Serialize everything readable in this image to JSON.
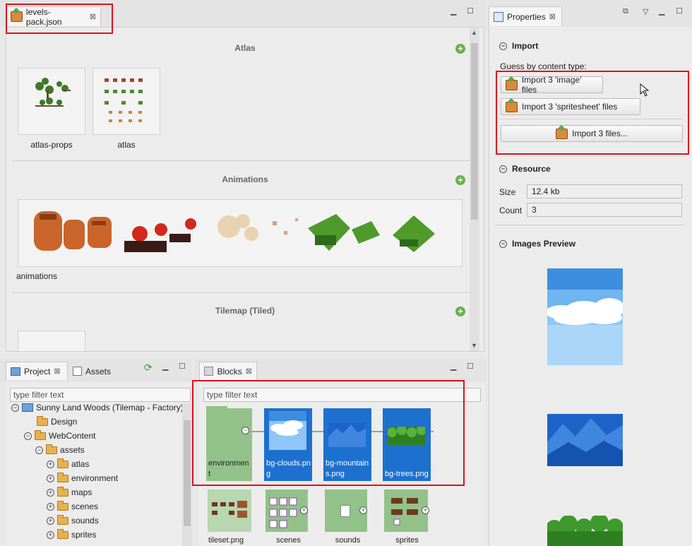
{
  "editor": {
    "tab_label": "levels-pack.json",
    "sections": [
      {
        "title": "Atlas"
      },
      {
        "title": "Animations"
      },
      {
        "title": "Tilemap (Tiled)"
      }
    ],
    "atlas_items": [
      "atlas-props",
      "atlas"
    ],
    "animation_items": [
      "animations"
    ]
  },
  "properties": {
    "tab_label": "Properties",
    "import": {
      "title": "Import",
      "guess_label": "Guess by content type:",
      "buttons": [
        "Import 3 'image' files",
        "Import 3 'spritesheet' files",
        "Import 3 files..."
      ]
    },
    "resource": {
      "title": "Resource",
      "size_label": "Size",
      "size_value": "12.4 kb",
      "count_label": "Count",
      "count_value": "3"
    },
    "preview": {
      "title": "Images Preview"
    }
  },
  "project": {
    "tabs": [
      "Project",
      "Assets"
    ],
    "filter_placeholder": "type filter text",
    "tree": [
      {
        "label": "Sunny Land Woods (Tilemap - Factory)"
      },
      {
        "label": "Design"
      },
      {
        "label": "WebContent"
      },
      {
        "label": "assets"
      },
      {
        "label": "atlas"
      },
      {
        "label": "environment"
      },
      {
        "label": "maps"
      },
      {
        "label": "scenes"
      },
      {
        "label": "sounds"
      },
      {
        "label": "sprites"
      }
    ]
  },
  "blocks": {
    "tab_label": "Blocks",
    "filter_placeholder": "type filter text",
    "row1": [
      "environment",
      "bg-clouds.png",
      "bg-mountains.png",
      "bg-trees.png"
    ],
    "row2": [
      "tileset.png",
      "scenes",
      "sounds",
      "sprites"
    ]
  },
  "colors": {
    "highlight_red": "#e0101b",
    "block_green": "#93c18a",
    "block_blue": "#1e70cf",
    "sky_blue": "#6fb5ef"
  }
}
